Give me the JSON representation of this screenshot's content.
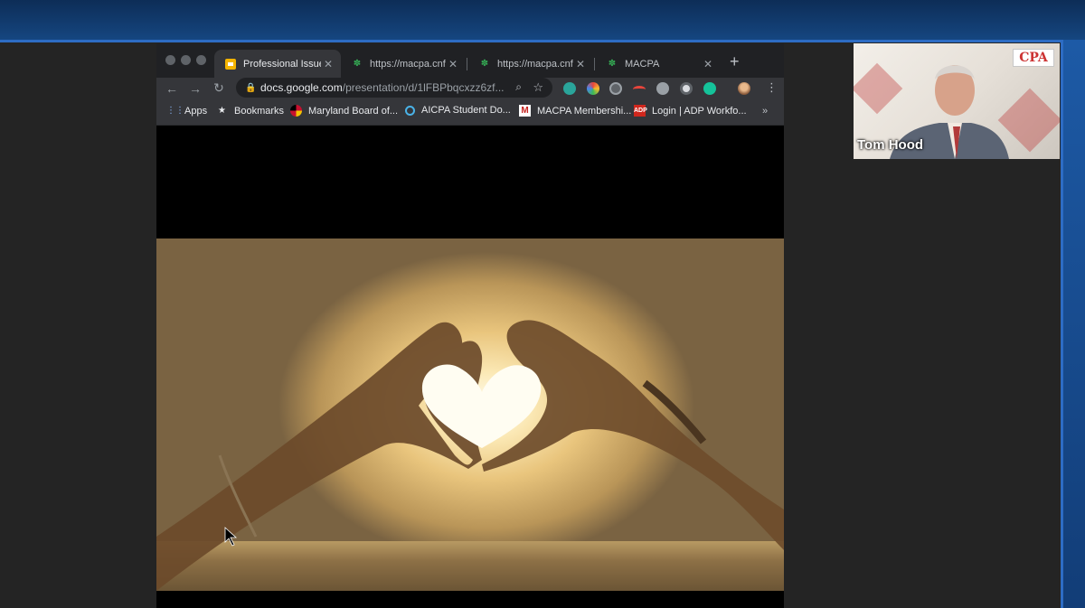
{
  "browser": {
    "tabs": [
      {
        "label": "Professional Issues",
        "favicon": "slides-icon",
        "active": true
      },
      {
        "label": "https://macpa.cnf.io/",
        "favicon": "cnf-icon",
        "active": false
      },
      {
        "label": "https://macpa.cnf.io/",
        "favicon": "cnf-icon",
        "active": false
      },
      {
        "label": "MACPA",
        "favicon": "cnf-icon",
        "active": false
      }
    ],
    "address": {
      "host": "docs.google.com",
      "path": "/presentation/d/1lFBPbqcxzz6zf..."
    },
    "bookmarks": [
      {
        "label": "Apps",
        "icon": "apps-grid-icon"
      },
      {
        "label": "Bookmarks",
        "icon": "star-icon"
      },
      {
        "label": "Maryland Board of...",
        "icon": "maryland-flag-icon"
      },
      {
        "label": "AICPA Student Do...",
        "icon": "aicpa-icon"
      },
      {
        "label": "MACPA Membershi...",
        "icon": "gmail-icon"
      },
      {
        "label": "Login | ADP Workfo...",
        "icon": "adp-icon"
      }
    ],
    "more_label": "»"
  },
  "participant": {
    "name": "Tom Hood",
    "logo_text": "CPA"
  },
  "colors": {
    "frame_blue": "#2d6cc4",
    "stage_bg": "#242424",
    "tab_active": "#35363a",
    "tabbar_bg": "#202124"
  }
}
